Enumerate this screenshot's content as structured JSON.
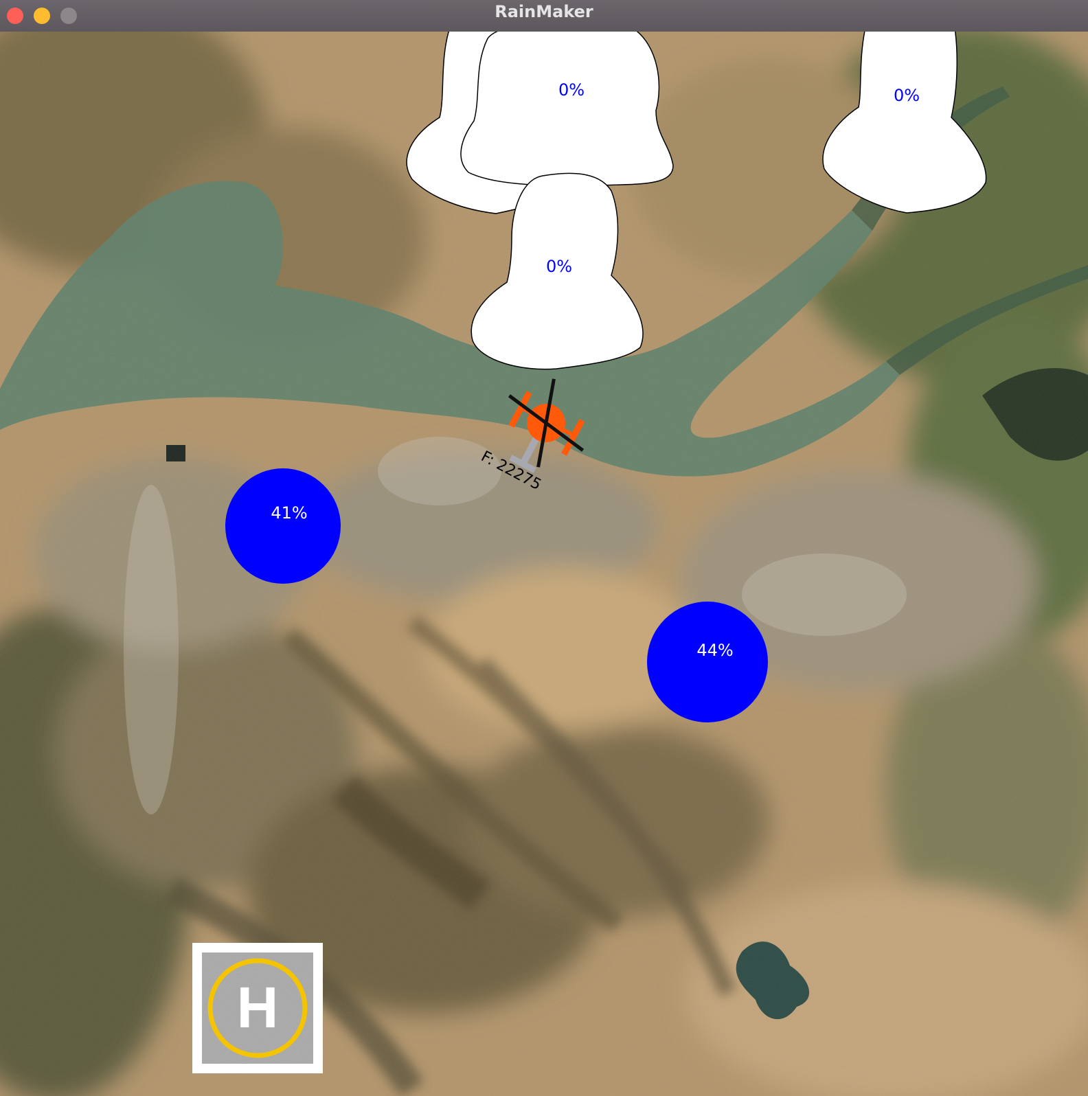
{
  "window": {
    "title": "RainMaker",
    "buttons": [
      "close",
      "minimize",
      "maximize"
    ]
  },
  "game": {
    "background": "satellite-terrain-map",
    "clouds": [
      {
        "id": "cloud-1",
        "label": "0%",
        "saturation": 0
      },
      {
        "id": "cloud-2",
        "label": "0%",
        "saturation": 0
      },
      {
        "id": "cloud-3",
        "label": "0%",
        "saturation": 0
      }
    ],
    "ponds": [
      {
        "id": "pond-1",
        "label": "41%",
        "fill": 41
      },
      {
        "id": "pond-2",
        "label": "44%",
        "fill": 44
      }
    ],
    "helicopter": {
      "fuel_label": "F: 22275",
      "fuel": 22275,
      "body_color": "#ff5a0a",
      "icon": "helicopter-icon"
    },
    "helipad": {
      "letter": "H",
      "ring_color": "#f5c400"
    },
    "colors": {
      "cloud": "#ffffff",
      "pond": "#0000ff",
      "cloud_text": "#0000ff",
      "pond_text": "#ffffff"
    }
  }
}
